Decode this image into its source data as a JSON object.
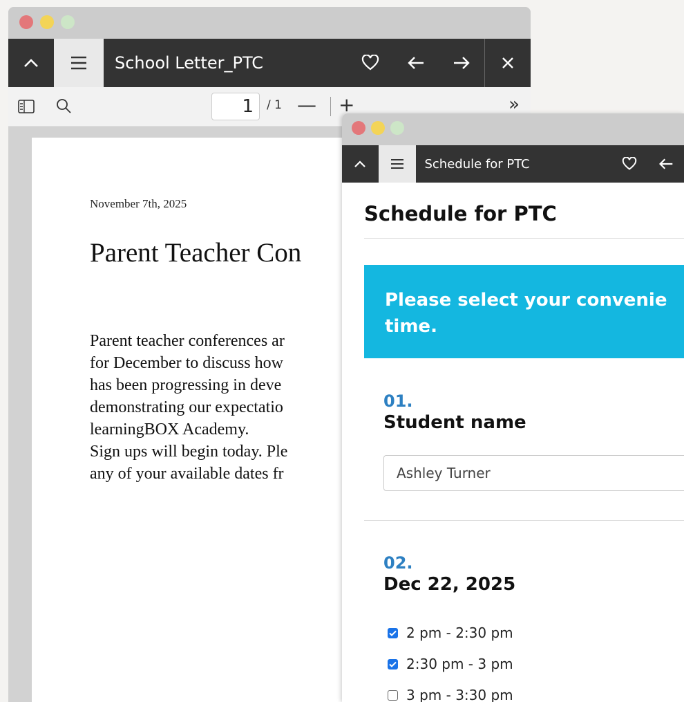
{
  "pdf_window": {
    "tab_title": "School Letter_PTC",
    "page_current": "1",
    "page_total": "/ 1",
    "zoom_out": "—",
    "zoom_in": "+",
    "more": "»",
    "document": {
      "date": "November 7th, 2025",
      "title": "Parent Teacher Con",
      "body_lines": [
        "Parent teacher conferences ar",
        "for December to discuss how",
        "has been  progressing in deve",
        "demonstrating our expectatio",
        "learningBOX Academy.",
        "Sign ups will begin today. Ple",
        "any of your available dates fr"
      ]
    }
  },
  "form_window": {
    "tab_title": "Schedule for PTC",
    "heading": "Schedule for PTC",
    "banner_text": "Please select your convenie time.",
    "banner_lines": [
      "Please select your convenie",
      "time."
    ],
    "banner_color": "#14b7e0",
    "question1": {
      "number": "01.",
      "title": "Student name",
      "value": "Ashley Turner"
    },
    "question2": {
      "number": "02.",
      "title": "Dec 22, 2025",
      "options": [
        {
          "label": "2 pm - 2:30 pm",
          "checked": true
        },
        {
          "label": "2:30 pm - 3 pm",
          "checked": true
        },
        {
          "label": "3 pm - 3:30 pm",
          "checked": false
        }
      ]
    }
  }
}
